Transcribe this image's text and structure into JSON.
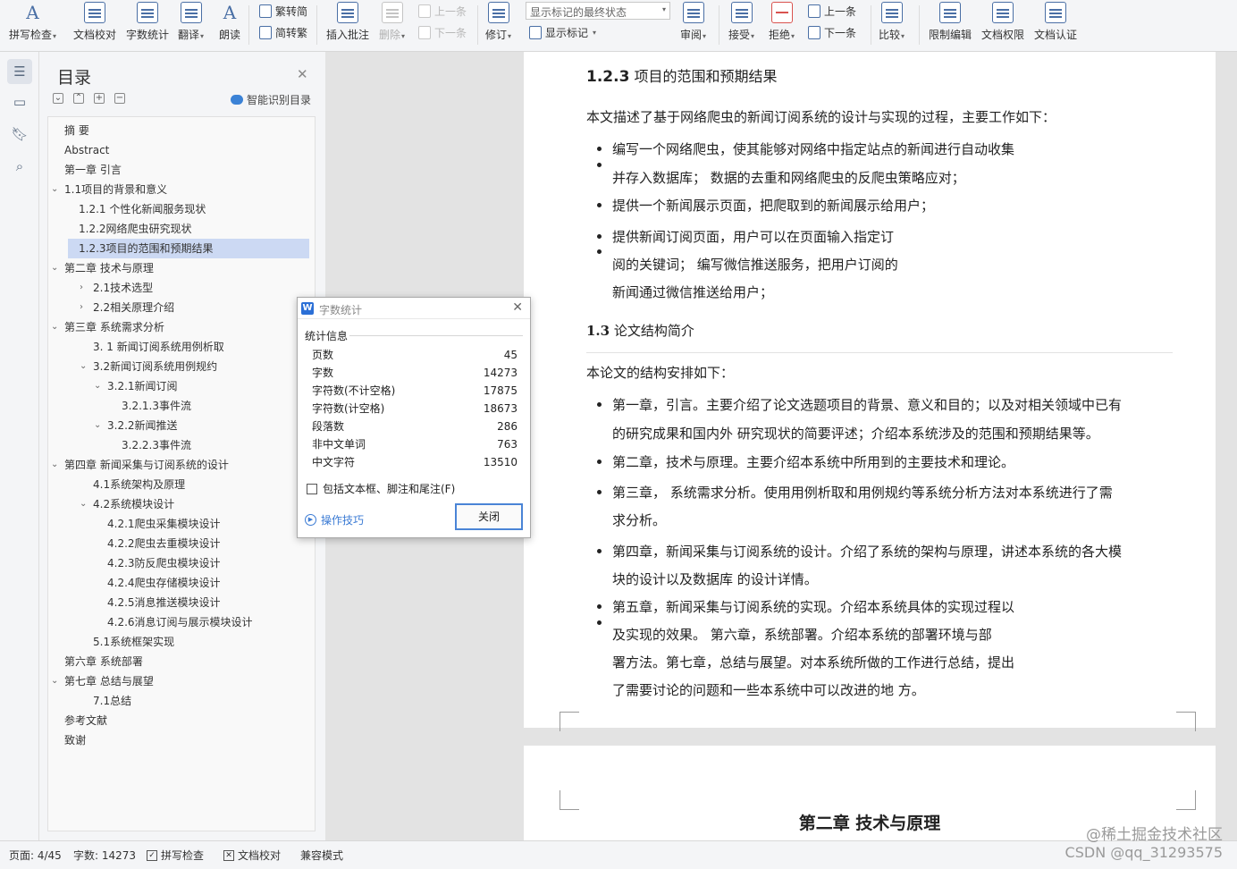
{
  "ribbon": {
    "spell_check": "拼写检查",
    "doc_proof": "文档校对",
    "word_count": "字数统计",
    "translate": "翻译",
    "read_aloud": "朗读",
    "trad_simp": "繁转简",
    "simp_trad": "简转繁",
    "insert_comment": "插入批注",
    "delete": "删除",
    "prev": "上一条",
    "next": "下一条",
    "revise": "修订",
    "markup_state": "显示标记的最终状态",
    "show_markup": "显示标记",
    "review": "审阅",
    "accept": "接受",
    "reject": "拒绝",
    "prev2": "上一条",
    "next2": "下一条",
    "compare": "比较",
    "restrict_edit": "限制编辑",
    "doc_rights": "文档权限",
    "doc_cert": "文档认证"
  },
  "toc": {
    "title": "目录",
    "smart": "智能识别目录",
    "items": [
      {
        "text": "摘  要"
      },
      {
        "text": "Abstract"
      },
      {
        "text": "第一章 引言"
      },
      {
        "text": "1.1项目的背景和意义"
      },
      {
        "text": "1.2.1 个性化新闻服务现状"
      },
      {
        "text": "1.2.2网络爬虫研究现状"
      },
      {
        "text": "1.2.3项目的范围和预期结果"
      },
      {
        "text": "第二章 技术与原理"
      },
      {
        "text": "2.1技术选型"
      },
      {
        "text": "2.2相关原理介绍"
      },
      {
        "text": "第三章 系统需求分析"
      },
      {
        "text": "3. 1 新闻订阅系统用例析取"
      },
      {
        "text": "3.2新闻订阅系统用例规约"
      },
      {
        "text": "3.2.1新闻订阅"
      },
      {
        "text": "3.2.1.3事件流"
      },
      {
        "text": "3.2.2新闻推送"
      },
      {
        "text": "3.2.2.3事件流"
      },
      {
        "text": "第四章 新闻采集与订阅系统的设计"
      },
      {
        "text": "4.1系统架构及原理"
      },
      {
        "text": "4.2系统模块设计"
      },
      {
        "text": "4.2.1爬虫采集模块设计"
      },
      {
        "text": "4.2.2爬虫去重模块设计"
      },
      {
        "text": "4.2.3防反爬虫模块设计"
      },
      {
        "text": "4.2.4爬虫存储模块设计"
      },
      {
        "text": "4.2.5消息推送模块设计"
      },
      {
        "text": "4.2.6消息订阅与展示模块设计"
      },
      {
        "text": "5.1系统框架实现"
      },
      {
        "text": "第六章 系统部署"
      },
      {
        "text": "第七章 总结与展望"
      },
      {
        "text": "7.1总结"
      },
      {
        "text": "参考文献"
      },
      {
        "text": "致谢"
      }
    ]
  },
  "doc": {
    "h123_num": "1.2.3",
    "h123_text": "项目的范围和预期结果",
    "p1": "本文描述了基于网络爬虫的新闻订阅系统的设计与实现的过程，主要工作如下：",
    "b1a": "编写一个网络爬虫，使其能够对网络中指定站点的新闻进行自动收集",
    "b1b": "并存入数据库；  数据的去重和网络爬虫的反爬虫策略应对；",
    "b2": "提供一个新闻展示页面，把爬取到的新闻展示给用户；",
    "b3a": "提供新闻订阅页面，用户可以在页面输入指定订",
    "b3b": "阅的关键词；  编写微信推送服务，把用户订阅的",
    "b3c": "新闻通过微信推送给用户；",
    "h13_num": "1.3",
    "h13_text": "论文结构简介",
    "p2": "本论文的结构安排如下：",
    "c1a": "第一章，引言。主要介绍了论文选题项目的背景、意义和目的；以及对相关领域中已有",
    "c1b": "的研究成果和国内外 研究现状的简要评述；介绍本系统涉及的范围和预期结果等。",
    "c2": "第二章，技术与原理。主要介绍本系统中所用到的主要技术和理论。",
    "c3a": "第三章，  系统需求分析。使用用例析取和用例规约等系统分析方法对本系统进行了需",
    "c3b": "求分析。",
    "c4a": "第四章，新闻采集与订阅系统的设计。介绍了系统的架构与原理，讲述本系统的各大模",
    "c4b": "块的设计以及数据库 的设计详情。",
    "c5a": "第五章，新闻采集与订阅系统的实现。介绍本系统具体的实现过程以",
    "c5b": "及实现的效果。  第六章，系统部署。介绍本系统的部署环境与部",
    "c5c": "署方法。第七章，总结与展望。对本系统所做的工作进行总结，提出",
    "c5d": "了需要讨论的问题和一些本系统中可以改进的地 方。",
    "ch2": "第二章  技术与原理"
  },
  "dialog": {
    "title": "字数统计",
    "section": "统计信息",
    "rows": [
      {
        "label": "页数",
        "value": "45"
      },
      {
        "label": "字数",
        "value": "14273"
      },
      {
        "label": "字符数(不计空格)",
        "value": "17875"
      },
      {
        "label": "字符数(计空格)",
        "value": "18673"
      },
      {
        "label": "段落数",
        "value": "286"
      },
      {
        "label": "非中文单词",
        "value": "763"
      },
      {
        "label": "中文字符",
        "value": "13510"
      }
    ],
    "include_label": "包括文本框、脚注和尾注(F)",
    "tips": "操作技巧",
    "close": "关闭"
  },
  "status": {
    "page": "页面: 4/45",
    "words": "字数: 14273",
    "spell": "拼写检查",
    "proof": "文档校对",
    "compat": "兼容模式"
  },
  "watermark": {
    "line1": "@稀土掘金技术社区",
    "line2": "CSDN @qq_31293575"
  }
}
